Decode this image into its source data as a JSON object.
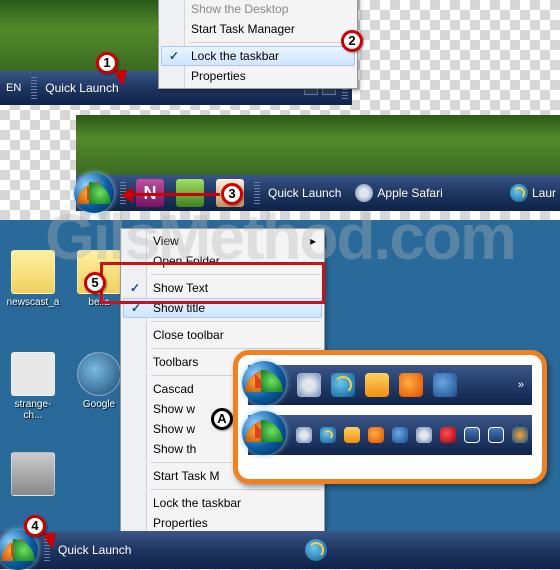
{
  "watermark": "GilsMethod.com",
  "badges": {
    "b1": "1",
    "b2": "2",
    "b3": "3",
    "b4": "4",
    "b5": "5",
    "bA": "A"
  },
  "panel1": {
    "lang": "EN",
    "toolbar_label": "Quick Launch",
    "menu": {
      "truncated_top": "Show the Desktop",
      "start_task_mgr": "Start Task Manager",
      "lock_taskbar": "Lock the taskbar",
      "properties": "Properties"
    }
  },
  "panel2": {
    "toolbar_label": "Quick Launch",
    "safari_label": "Apple Safari",
    "launch_trunc": "Laur"
  },
  "panel3": {
    "menu": {
      "view": "View",
      "open_folder": "Open Folder",
      "show_text": "Show Text",
      "show_title": "Show title",
      "close_toolbar": "Close toolbar",
      "toolbars": "Toolbars",
      "cascade": "Cascad",
      "show_stacked": "Show w",
      "show_side": "Show w",
      "show_desktop": "Show th",
      "start_task_mgr": "Start Task M",
      "lock_taskbar": "Lock the taskbar",
      "properties": "Properties"
    },
    "toolbar_label": "Quick Launch",
    "desk": {
      "newscast": "newscast_a",
      "bella": "bella",
      "strange": "strange-ch...",
      "google": "Google"
    }
  }
}
